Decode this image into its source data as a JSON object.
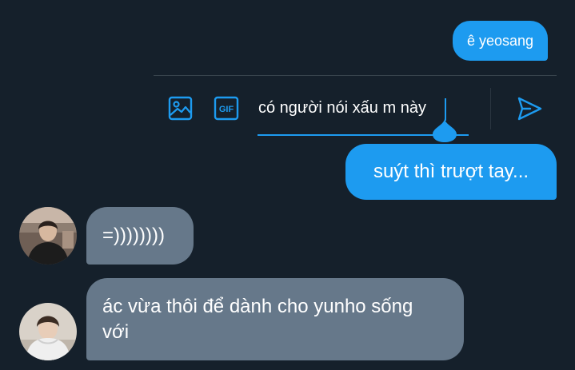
{
  "messages": [
    {
      "side": "sent",
      "text": "ê yeosang"
    },
    {
      "side": "sent",
      "text": "suýt thì trượt tay..."
    },
    {
      "side": "received",
      "text": "=))))))))"
    },
    {
      "side": "received",
      "text": "ác vừa thôi để dành cho yunho sống với"
    }
  ],
  "composer": {
    "value": "có người nói xấu m này",
    "gif_label": "GIF",
    "image_icon": "image-icon",
    "gif_icon": "gif-icon",
    "send_icon": "send-icon"
  },
  "colors": {
    "background": "#15202b",
    "sent_bubble": "#1d9bf0",
    "received_bubble": "#66788a",
    "accent": "#1d9bf0"
  }
}
